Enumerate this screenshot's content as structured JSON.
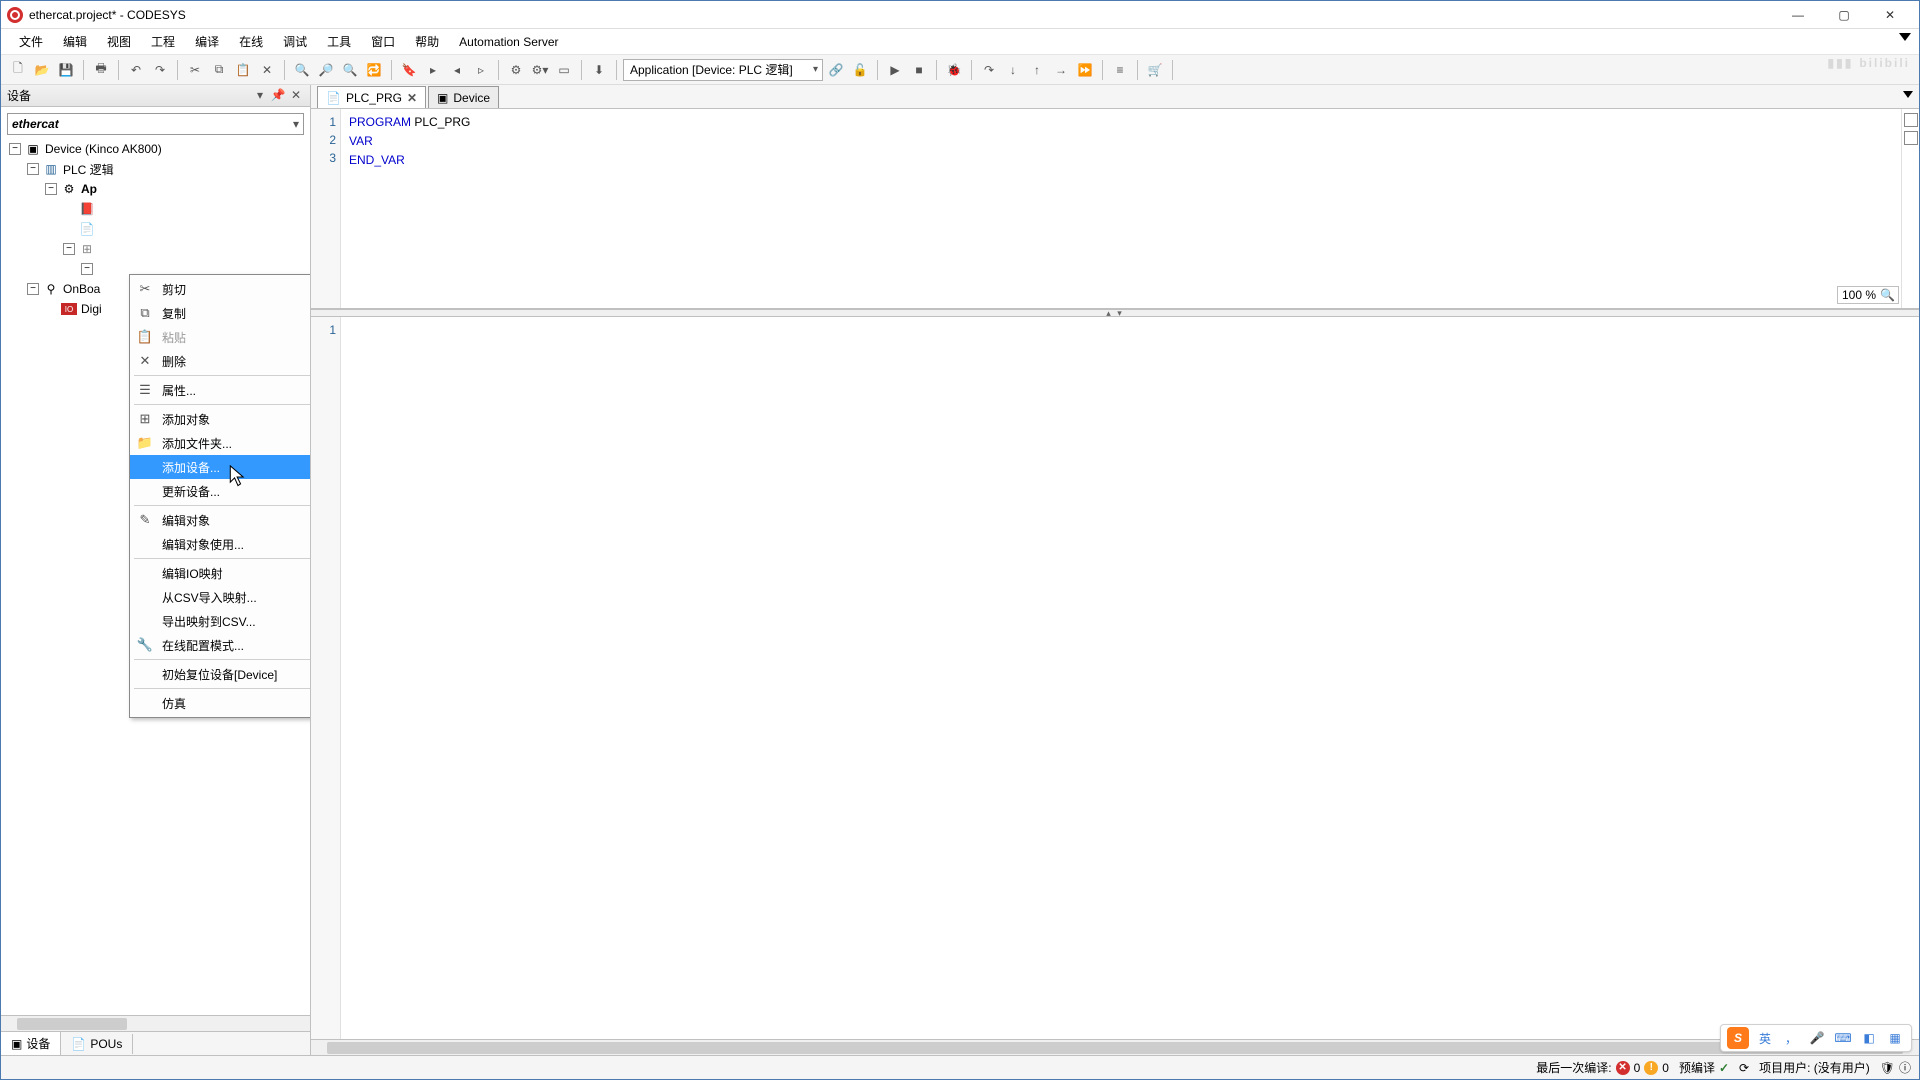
{
  "title": "ethercat.project* - CODESYS",
  "menubar": [
    "文件",
    "编辑",
    "视图",
    "工程",
    "编译",
    "在线",
    "调试",
    "工具",
    "窗口",
    "帮助",
    "Automation Server"
  ],
  "toolbar": {
    "combo": "Application [Device: PLC 逻辑]"
  },
  "left": {
    "panelTitle": "设备",
    "project": "ethercat",
    "device": "Device (Kinco AK800)",
    "plc": "PLC 逻辑",
    "app": "Ap",
    "onboard": "OnBoa",
    "digi": "Digi",
    "tabDevices": "设备",
    "tabPous": "POUs"
  },
  "tabs": {
    "t1": "PLC_PRG",
    "t2": "Device"
  },
  "code": {
    "l1a": "PROGRAM",
    "l1b": " PLC_PRG",
    "l2": "VAR",
    "l3": "END_VAR",
    "g1": "1",
    "g2": "2",
    "g3": "3",
    "gb1": "1"
  },
  "zoom": "100 %",
  "ctx": {
    "cut": "剪切",
    "copy": "复制",
    "paste": "粘贴",
    "delete": "删除",
    "props": "属性...",
    "addObj": "添加对象",
    "addFolder": "添加文件夹...",
    "addDev": "添加设备...",
    "updDev": "更新设备...",
    "editObj": "编辑对象",
    "editObjUse": "编辑对象使用...",
    "editIoMap": "编辑IO映射",
    "impCsv": "从CSV导入映射...",
    "expCsv": "导出映射到CSV...",
    "onlineCfg": "在线配置模式...",
    "initReset": "初始复位设备[Device]",
    "sim": "仿真"
  },
  "status": {
    "lastCompile": "最后一次编译:",
    "errCount": "0",
    "warnCount": "0",
    "precompile": "预编译",
    "projectUser": "项目用户: (没有用户)"
  },
  "ime": {
    "lang": "英"
  },
  "watermark": "bilibili"
}
